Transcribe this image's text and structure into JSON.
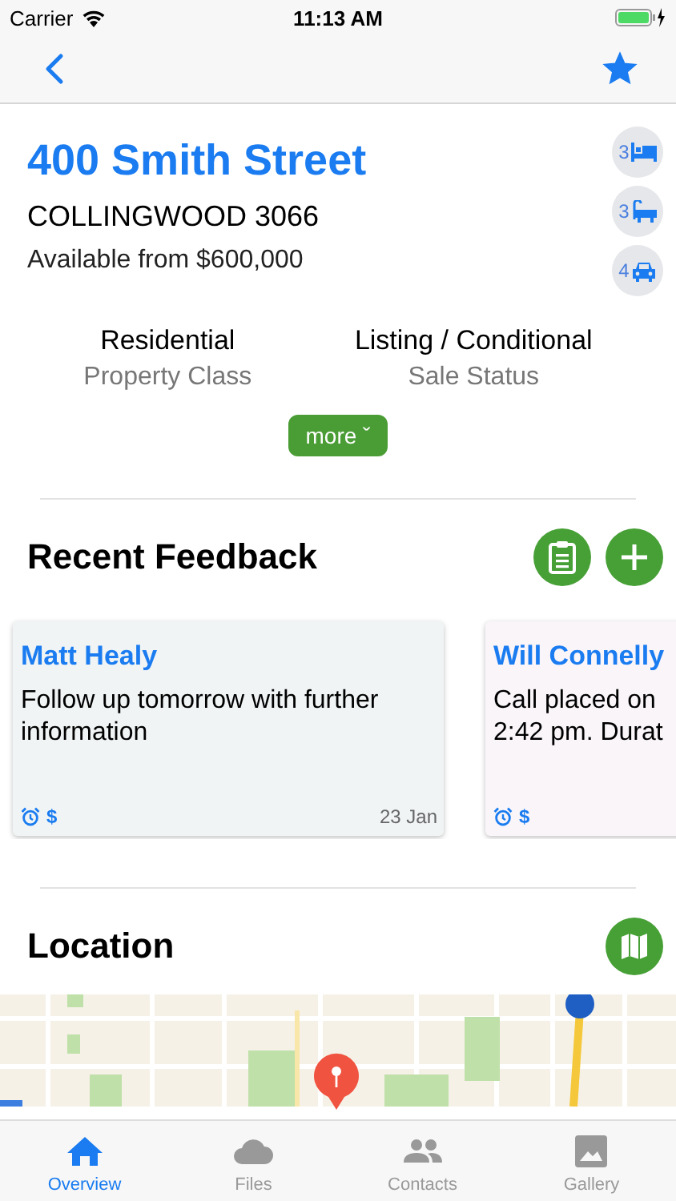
{
  "status_bar": {
    "carrier": "Carrier",
    "time": "11:13 AM"
  },
  "nav_bar": {
    "favorite": true
  },
  "property": {
    "title": "400 Smith Street",
    "suburb": "COLLINGWOOD 3066",
    "price": "Available from $600,000",
    "features": [
      {
        "kind": "bed",
        "count": "3"
      },
      {
        "kind": "bath",
        "count": "3"
      },
      {
        "kind": "car",
        "count": "4"
      }
    ],
    "details": [
      {
        "value": "Residential",
        "label": "Property Class"
      },
      {
        "value": "Listing / Conditional",
        "label": "Sale Status"
      }
    ],
    "more_button": "more ˇ"
  },
  "feedback": {
    "title": "Recent Feedback",
    "cards": [
      {
        "name": "Matt Healy",
        "body": "Follow up tomorrow with further information",
        "currency_mark": "$",
        "date": "23 Jan"
      },
      {
        "name": "Will Connelly",
        "body": "Call placed on\n2:42 pm. Durat",
        "currency_mark": "$"
      }
    ]
  },
  "location": {
    "title": "Location"
  },
  "tab_bar": [
    {
      "label": "Overview",
      "selected": true
    },
    {
      "label": "Files",
      "selected": false
    },
    {
      "label": "Contacts",
      "selected": false
    },
    {
      "label": "Gallery",
      "selected": false
    }
  ]
}
